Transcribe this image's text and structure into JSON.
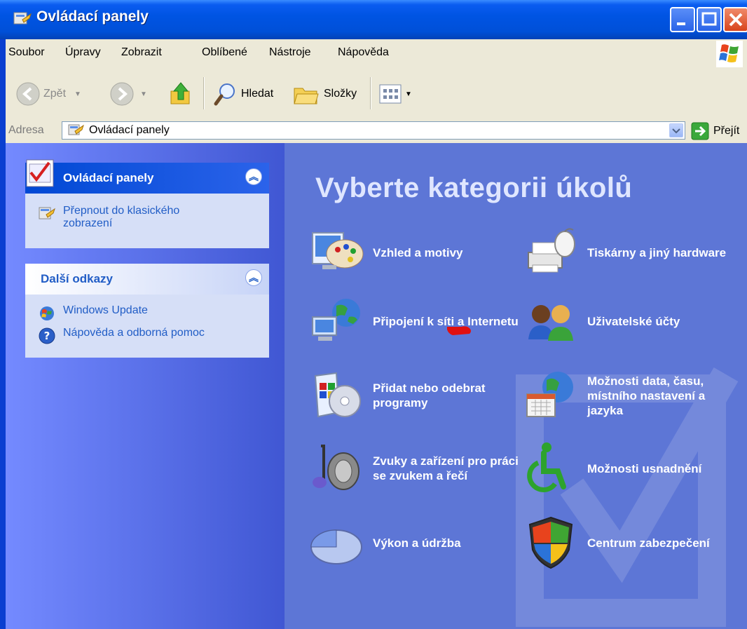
{
  "window": {
    "title": "Ovládací panely"
  },
  "menu": [
    "Soubor",
    "Úpravy",
    "Zobrazit",
    "Oblíbené",
    "Nástroje",
    "Nápověda"
  ],
  "toolbar": {
    "back": "Zpět",
    "search": "Hledat",
    "folders": "Složky"
  },
  "address": {
    "label": "Adresa",
    "value": "Ovládací panely",
    "go": "Přejít"
  },
  "sidebar": {
    "panel1": {
      "title": "Ovládací panely",
      "link": "Přepnout do klasického zobrazení"
    },
    "panel2": {
      "title": "Další odkazy",
      "links": [
        "Windows Update",
        "Nápověda a odborná pomoc"
      ]
    }
  },
  "main": {
    "heading": "Vyberte kategorii úkolů",
    "categories": [
      {
        "label": "Vzhled a motivy",
        "icon": "appearance-icon"
      },
      {
        "label": "Tiskárny a jiný hardware",
        "icon": "printer-icon"
      },
      {
        "label": "Připojení k síti a Internetu",
        "icon": "network-icon"
      },
      {
        "label": "Uživatelské účty",
        "icon": "users-icon"
      },
      {
        "label": "Přidat nebo odebrat programy",
        "icon": "add-remove-icon"
      },
      {
        "label": "Možnosti data, času, místního nastavení a jazyka",
        "icon": "date-time-icon"
      },
      {
        "label": "Zvuky a zařízení pro práci se zvukem a řečí",
        "icon": "sound-icon"
      },
      {
        "label": "Možnosti usnadnění",
        "icon": "accessibility-icon"
      },
      {
        "label": "Výkon a údržba",
        "icon": "performance-icon"
      },
      {
        "label": "Centrum zabezpečení",
        "icon": "security-shield-icon"
      }
    ]
  }
}
